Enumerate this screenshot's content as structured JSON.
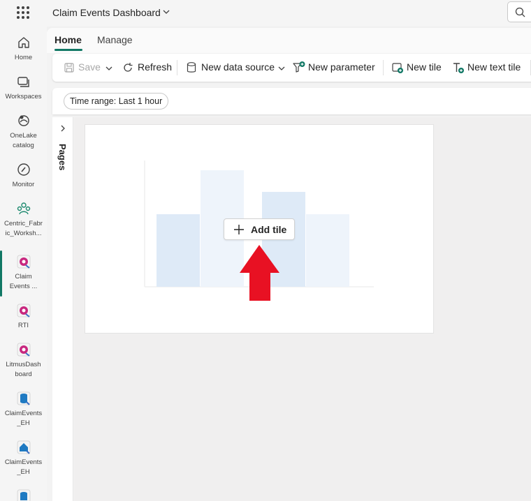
{
  "app": {
    "title": "Claim Events Dashboard"
  },
  "rail": {
    "items": [
      {
        "label_lines": [
          "Home"
        ],
        "icon": "home-icon"
      },
      {
        "label_lines": [
          "Workspaces"
        ],
        "icon": "workspaces-icon"
      },
      {
        "label_lines": [
          "OneLake",
          "catalog"
        ],
        "icon": "onelake-icon"
      },
      {
        "label_lines": [
          "Monitor"
        ],
        "icon": "monitor-icon"
      },
      {
        "label_lines": [
          "Centric_Fabr",
          "ic_Worksh..."
        ],
        "icon": "workspace-group-icon"
      },
      {
        "label_lines": [
          "Claim",
          "Events ..."
        ],
        "icon": "dashboard-icon"
      },
      {
        "label_lines": [
          "RTI"
        ],
        "icon": "dashboard-icon"
      },
      {
        "label_lines": [
          "LitmusDash",
          "board"
        ],
        "icon": "dashboard-icon"
      },
      {
        "label_lines": [
          "ClaimEvents",
          "_EH"
        ],
        "icon": "eventhouse-icon"
      },
      {
        "label_lines": [
          "ClaimEvents",
          "_EH"
        ],
        "icon": "eventhouse-icon"
      }
    ]
  },
  "tabs": {
    "home": "Home",
    "manage": "Manage"
  },
  "toolbar": {
    "save": "Save",
    "refresh": "Refresh",
    "new_data_source": "New data source",
    "new_parameter": "New parameter",
    "new_tile": "New tile",
    "new_text_tile": "New text tile"
  },
  "filters": {
    "time_range": "Time range: Last 1 hour"
  },
  "pages": {
    "label": "Pages"
  },
  "empty_tile": {
    "add_tile": "Add tile"
  },
  "colors": {
    "accent": "#117865",
    "arrow": "#e81123",
    "bar_light": "#eef4fb",
    "bar_mid": "#deeaf7"
  }
}
